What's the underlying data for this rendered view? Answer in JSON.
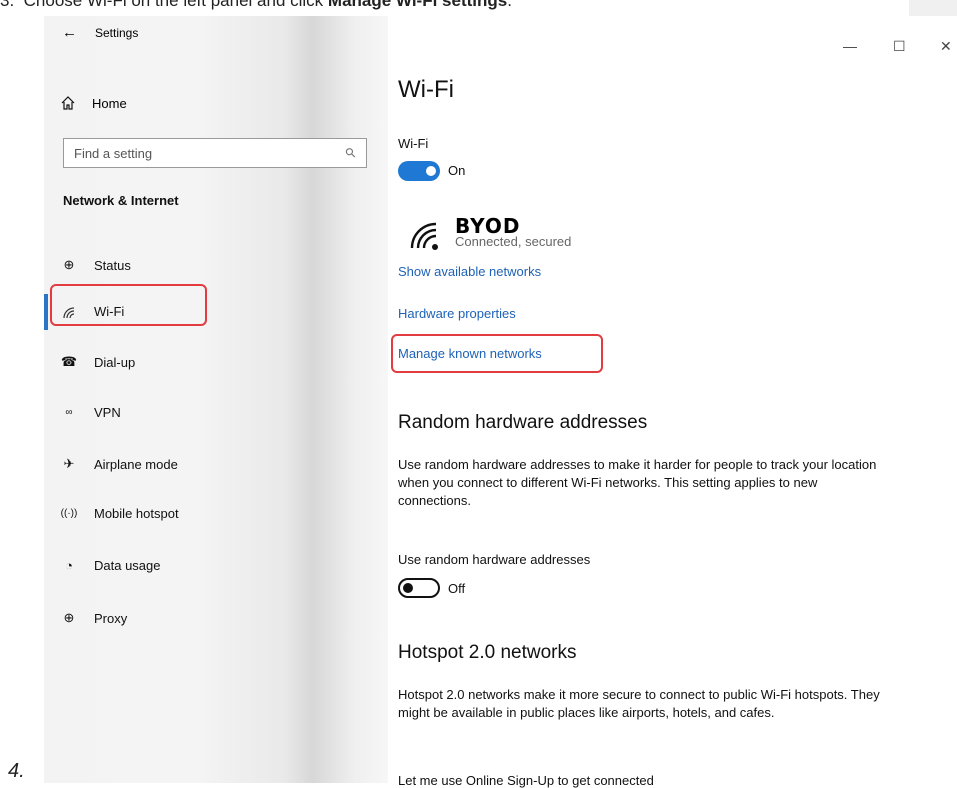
{
  "instruction": {
    "number": "3.",
    "text": "Choose Wi-Fi on the left panel and click ",
    "bold": "Manage Wi-Fi settings",
    "end": "."
  },
  "next_step_number": "4.",
  "window": {
    "title": "Settings"
  },
  "sidebar": {
    "home_label": "Home",
    "search_placeholder": "Find a setting",
    "section_title": "Network & Internet",
    "items": [
      {
        "label": "Status",
        "icon": "globe-status-icon"
      },
      {
        "label": "Wi-Fi",
        "icon": "wifi-icon",
        "active": true
      },
      {
        "label": "Dial-up",
        "icon": "phone-icon"
      },
      {
        "label": "VPN",
        "icon": "vpn-icon"
      },
      {
        "label": "Airplane mode",
        "icon": "airplane-icon"
      },
      {
        "label": "Mobile hotspot",
        "icon": "hotspot-icon"
      },
      {
        "label": "Data usage",
        "icon": "pie-chart-icon"
      },
      {
        "label": "Proxy",
        "icon": "globe-icon"
      }
    ]
  },
  "main": {
    "title": "Wi-Fi",
    "wifi_label": "Wi-Fi",
    "wifi_toggle_state": "On",
    "network": {
      "ssid": "BYOD",
      "status": "Connected, secured"
    },
    "links": {
      "show_available": "Show available networks",
      "hardware_properties": "Hardware properties",
      "manage_known": "Manage known networks"
    },
    "random_hw": {
      "heading": "Random hardware addresses",
      "description": "Use random hardware addresses to make it harder for people to track your location when you connect to different Wi-Fi networks. This setting applies to new connections.",
      "toggle_label": "Use random hardware addresses",
      "toggle_state": "Off"
    },
    "hotspot20": {
      "heading": "Hotspot 2.0 networks",
      "description": "Hotspot 2.0 networks make it more secure to connect to public Wi-Fi hotspots. They might be available in public places like airports, hotels, and cafes.",
      "partial_text": "Let me use Online Sign-Up to get connected"
    }
  },
  "colors": {
    "accent": "#1e78d4",
    "link": "#1e62b6",
    "highlight": "#e23b40"
  }
}
